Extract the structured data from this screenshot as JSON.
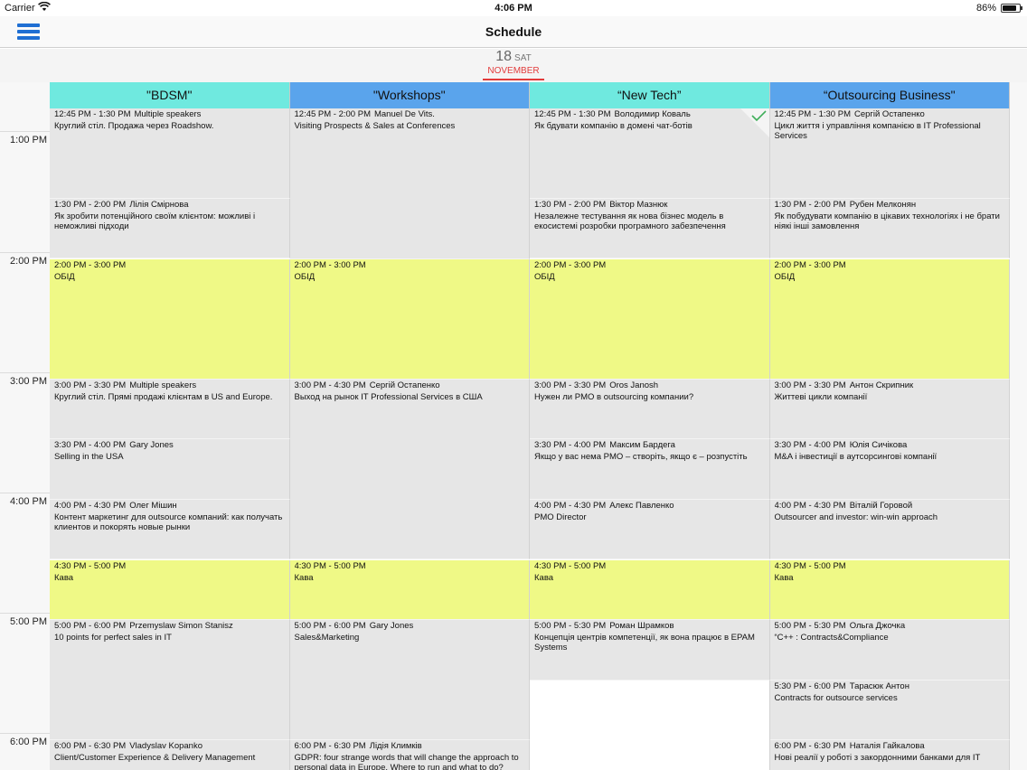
{
  "status_bar": {
    "carrier": "Carrier",
    "time": "4:06 PM",
    "battery": "86%",
    "battery_level": 0.86
  },
  "nav": {
    "title": "Schedule",
    "menu_icon": "hamburger-menu-icon"
  },
  "date": {
    "day": "18",
    "weekday": "SAT",
    "month": "NOVEMBER"
  },
  "colors": {
    "track_cyan": "#6fe9df",
    "track_blue": "#5aa4ec",
    "session_gray": "#e6e6e6",
    "break_yellow": "#eff986",
    "accent_red": "#e23b3b",
    "menu_blue": "#1f6fd3"
  },
  "time_labels": [
    "1:00 PM",
    "2:00 PM",
    "3:00 PM",
    "4:00 PM",
    "5:00 PM",
    "6:00 PM"
  ],
  "tracks": [
    {
      "name": "\"BDSM\"",
      "color": "#6fe9df"
    },
    {
      "name": "\"Workshops\"",
      "color": "#5aa4ec"
    },
    {
      "name": "“New Tech”",
      "color": "#6fe9df"
    },
    {
      "name": "“Outsourcing Business\"",
      "color": "#5aa4ec"
    }
  ],
  "sessions": [
    {
      "track": 0,
      "start": "12:45",
      "end": "13:30",
      "time": "12:45 PM - 1:30 PM",
      "speaker": "Multiple speakers",
      "title": "Круглий стіл. Продажа через Roadshow."
    },
    {
      "track": 0,
      "start": "13:30",
      "end": "14:00",
      "time": "1:30 PM - 2:00 PM",
      "speaker": "Лілія Смірнова",
      "title": "Як зробити потенційного своїм клієнтом: можливі і неможливі підходи"
    },
    {
      "track": 0,
      "start": "14:00",
      "end": "15:00",
      "time": "2:00 PM - 3:00 PM",
      "speaker": "",
      "title": "ОБІД",
      "break": true
    },
    {
      "track": 0,
      "start": "15:00",
      "end": "15:30",
      "time": "3:00 PM - 3:30 PM",
      "speaker": "Multiple speakers",
      "title": "Круглий стіл. Прямі продажі клієнтам в US and Europe."
    },
    {
      "track": 0,
      "start": "15:30",
      "end": "16:00",
      "time": "3:30 PM - 4:00 PM",
      "speaker": "Gary Jones",
      "title": "Selling in the USA"
    },
    {
      "track": 0,
      "start": "16:00",
      "end": "16:30",
      "time": "4:00 PM - 4:30 PM",
      "speaker": "Олег Мішин",
      "title": "Контент маркетинг для outsource компаний: как получать клиентов и покорять новые рынки"
    },
    {
      "track": 0,
      "start": "16:30",
      "end": "17:00",
      "time": "4:30 PM - 5:00 PM",
      "speaker": "",
      "title": "Кава",
      "break": true
    },
    {
      "track": 0,
      "start": "17:00",
      "end": "18:00",
      "time": "5:00 PM - 6:00 PM",
      "speaker": "Przemyslaw Simon Stanisz",
      "title": "10 points for perfect sales in IT"
    },
    {
      "track": 0,
      "start": "18:00",
      "end": "18:30",
      "time": "6:00 PM - 6:30 PM",
      "speaker": "Vladyslav Kopanko",
      "title": "Client/Customer Experience & Delivery Management"
    },
    {
      "track": 1,
      "start": "12:45",
      "end": "14:00",
      "time": "12:45 PM - 2:00 PM",
      "speaker": "Manuel De Vits.",
      "title": "Visiting Prospects & Sales at Conferences"
    },
    {
      "track": 1,
      "start": "14:00",
      "end": "15:00",
      "time": "2:00 PM - 3:00 PM",
      "speaker": "",
      "title": "ОБІД",
      "break": true
    },
    {
      "track": 1,
      "start": "15:00",
      "end": "16:30",
      "time": "3:00 PM - 4:30 PM",
      "speaker": "Сергій Остапенко",
      "title": "Выход на рынок IT Professional Services в США"
    },
    {
      "track": 1,
      "start": "16:30",
      "end": "17:00",
      "time": "4:30 PM - 5:00 PM",
      "speaker": "",
      "title": "Кава",
      "break": true
    },
    {
      "track": 1,
      "start": "17:00",
      "end": "18:00",
      "time": "5:00 PM - 6:00 PM",
      "speaker": "Gary Jones",
      "title": "Sales&Marketing"
    },
    {
      "track": 1,
      "start": "18:00",
      "end": "18:30",
      "time": "6:00 PM - 6:30 PM",
      "speaker": "Лідія Климків",
      "title": "GDPR: four strange words that will change the approach to personal data in Europe. Where to run and what to do?"
    },
    {
      "track": 2,
      "start": "12:45",
      "end": "13:30",
      "time": "12:45 PM - 1:30 PM",
      "speaker": "Володимир Коваль",
      "title": "Як бдувати компанію в домені чат-ботів",
      "checked": true
    },
    {
      "track": 2,
      "start": "13:30",
      "end": "14:00",
      "time": "1:30 PM - 2:00 PM",
      "speaker": "Віктор Мазнюк",
      "title": "Незалежне тестування як нова бізнес модель в екосистемі розробки програмного забезпечення"
    },
    {
      "track": 2,
      "start": "14:00",
      "end": "15:00",
      "time": "2:00 PM - 3:00 PM",
      "speaker": "",
      "title": "ОБІД",
      "break": true
    },
    {
      "track": 2,
      "start": "15:00",
      "end": "15:30",
      "time": "3:00 PM - 3:30 PM",
      "speaker": "Oros Janosh",
      "title": "Нужен ли PMO в outsourcing компании?"
    },
    {
      "track": 2,
      "start": "15:30",
      "end": "16:00",
      "time": "3:30 PM - 4:00 PM",
      "speaker": "Максим Бардега",
      "title": "Якщо у вас нема PMO – створіть, якщо є – розпустіть"
    },
    {
      "track": 2,
      "start": "16:00",
      "end": "16:30",
      "time": "4:00 PM - 4:30 PM",
      "speaker": "Алекс Павленко",
      "title": "PMO Director"
    },
    {
      "track": 2,
      "start": "16:30",
      "end": "17:00",
      "time": "4:30 PM - 5:00 PM",
      "speaker": "",
      "title": "Кава",
      "break": true
    },
    {
      "track": 2,
      "start": "17:00",
      "end": "17:30",
      "time": "5:00 PM - 5:30 PM",
      "speaker": "Роман Шрамков",
      "title": "Концепція центрів компетенції, як вона працює в EPAM Systems"
    },
    {
      "track": 3,
      "start": "12:45",
      "end": "13:30",
      "time": "12:45 PM - 1:30 PM",
      "speaker": "Сергій Остапенко",
      "title": "Цикл життя і управління компанією в IT Professional Services"
    },
    {
      "track": 3,
      "start": "13:30",
      "end": "14:00",
      "time": "1:30 PM - 2:00 PM",
      "speaker": "Рубен Мелконян",
      "title": "Як побудувати компанію в цікавих технологіях і не брати ніякі інші замовлення"
    },
    {
      "track": 3,
      "start": "14:00",
      "end": "15:00",
      "time": "2:00 PM - 3:00 PM",
      "speaker": "",
      "title": "ОБІД",
      "break": true
    },
    {
      "track": 3,
      "start": "15:00",
      "end": "15:30",
      "time": "3:00 PM - 3:30 PM",
      "speaker": "Антон Скрипник",
      "title": "Життеві цикли компанії"
    },
    {
      "track": 3,
      "start": "15:30",
      "end": "16:00",
      "time": "3:30 PM - 4:00 PM",
      "speaker": "Юлія Сичікова",
      "title": "M&A і інвестиції в аутсорсингові компанії"
    },
    {
      "track": 3,
      "start": "16:00",
      "end": "16:30",
      "time": "4:00 PM - 4:30 PM",
      "speaker": "Віталій Горовой",
      "title": "Outsourcer and investor: win-win approach"
    },
    {
      "track": 3,
      "start": "16:30",
      "end": "17:00",
      "time": "4:30 PM - 5:00 PM",
      "speaker": "",
      "title": "Кава",
      "break": true
    },
    {
      "track": 3,
      "start": "17:00",
      "end": "17:30",
      "time": "5:00 PM - 5:30 PM",
      "speaker": "Ольга Джочка",
      "title": "“C++ : Contracts&Compliance"
    },
    {
      "track": 3,
      "start": "17:30",
      "end": "18:00",
      "time": "5:30 PM - 6:00 PM",
      "speaker": "Тарасюк Антон",
      "title": "Contracts for outsource services"
    },
    {
      "track": 3,
      "start": "18:00",
      "end": "18:30",
      "time": "6:00 PM - 6:30 PM",
      "speaker": "Наталія Гайкалова",
      "title": "Нові реалії у роботі з закордонними банками для IT"
    }
  ]
}
